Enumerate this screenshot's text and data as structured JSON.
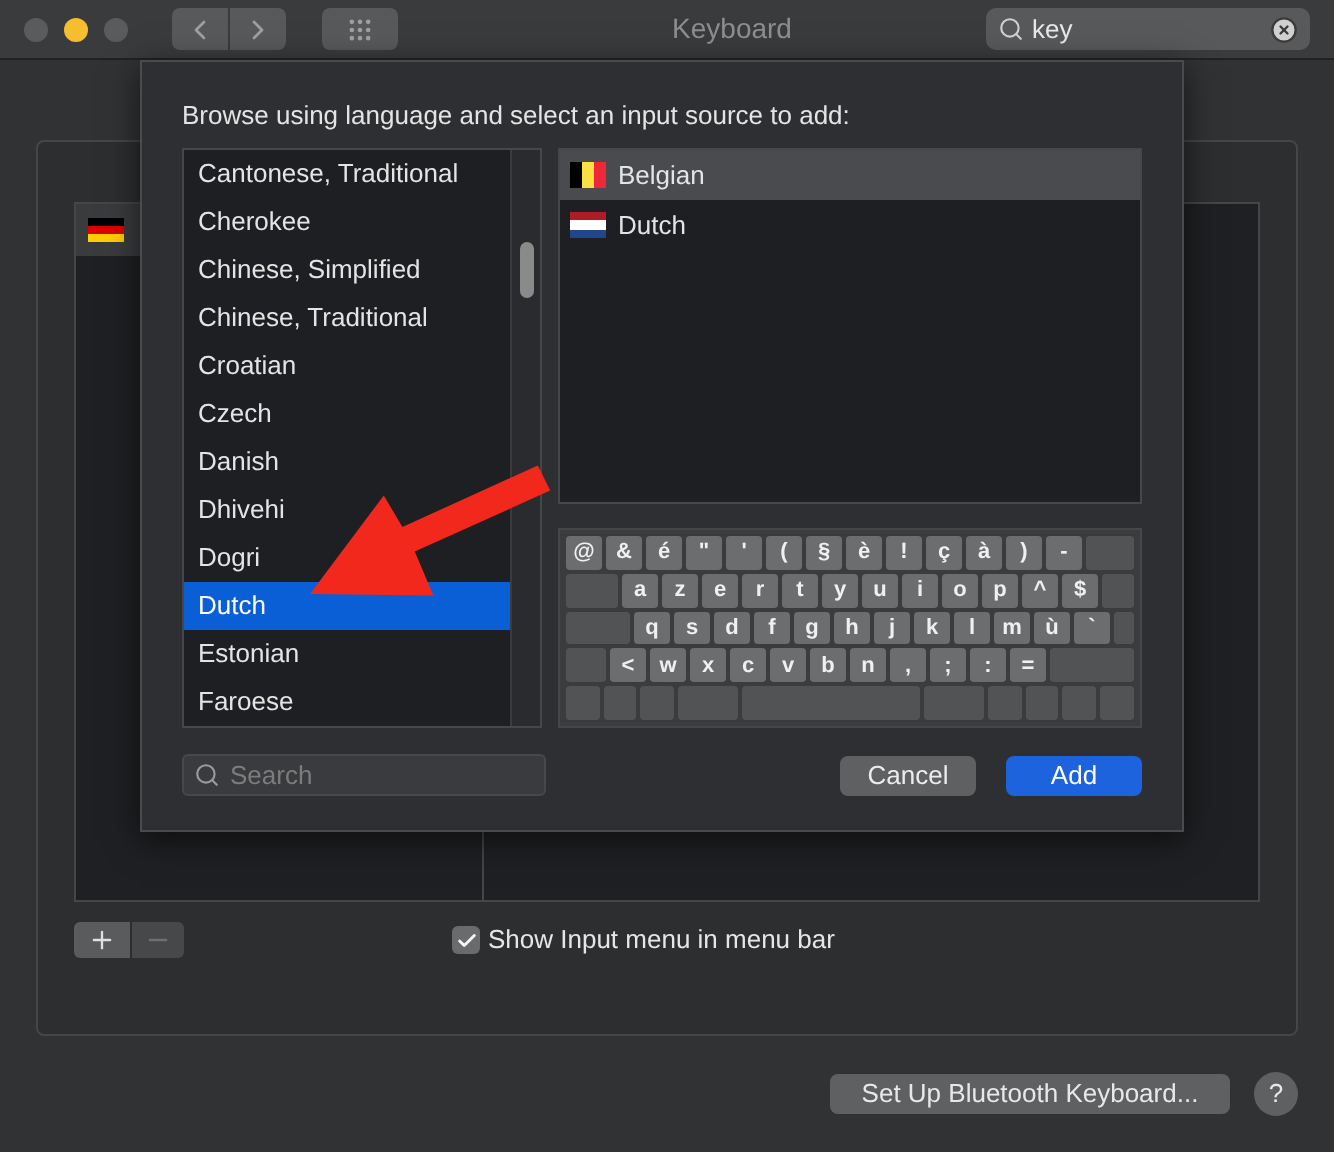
{
  "window": {
    "title": "Keyboard",
    "search": {
      "value": "key"
    }
  },
  "background": {
    "sources": [
      {
        "kind": "germany"
      }
    ],
    "remove_disabled": true,
    "show_input_menu": {
      "label": "Show Input menu in menu bar",
      "checked": true
    },
    "bluetooth_button": "Set Up Bluetooth Keyboard...",
    "help": "?"
  },
  "sheet": {
    "prompt": "Browse using language and select an input source to add:",
    "languages": [
      {
        "label": "Cantonese, Traditional",
        "selected": false
      },
      {
        "label": "Cherokee",
        "selected": false
      },
      {
        "label": "Chinese, Simplified",
        "selected": false
      },
      {
        "label": "Chinese, Traditional",
        "selected": false
      },
      {
        "label": "Croatian",
        "selected": false
      },
      {
        "label": "Czech",
        "selected": false
      },
      {
        "label": "Danish",
        "selected": false
      },
      {
        "label": "Dhivehi",
        "selected": false
      },
      {
        "label": "Dogri",
        "selected": false
      },
      {
        "label": "Dutch",
        "selected": true
      },
      {
        "label": "Estonian",
        "selected": false
      },
      {
        "label": "Faroese",
        "selected": false
      }
    ],
    "sources": [
      {
        "label": "Belgian",
        "kind": "belgium",
        "selected": true
      },
      {
        "label": "Dutch",
        "kind": "netherlands",
        "selected": false
      }
    ],
    "keyboard": {
      "rows": [
        [
          "@",
          "&",
          "é",
          "\"",
          "'",
          "(",
          "§",
          "è",
          "!",
          "ç",
          "à",
          ")",
          "-"
        ],
        [
          "a",
          "z",
          "e",
          "r",
          "t",
          "y",
          "u",
          "i",
          "o",
          "p",
          "^",
          "$"
        ],
        [
          "q",
          "s",
          "d",
          "f",
          "g",
          "h",
          "j",
          "k",
          "l",
          "m",
          "ù",
          "`"
        ],
        [
          "<",
          "w",
          "x",
          "c",
          "v",
          "b",
          "n",
          ",",
          ";",
          ":",
          "="
        ]
      ]
    },
    "search": {
      "placeholder": "Search"
    },
    "buttons": [
      {
        "label": "Cancel",
        "kind": "secondary"
      },
      {
        "label": "Add",
        "kind": "primary"
      }
    ]
  }
}
